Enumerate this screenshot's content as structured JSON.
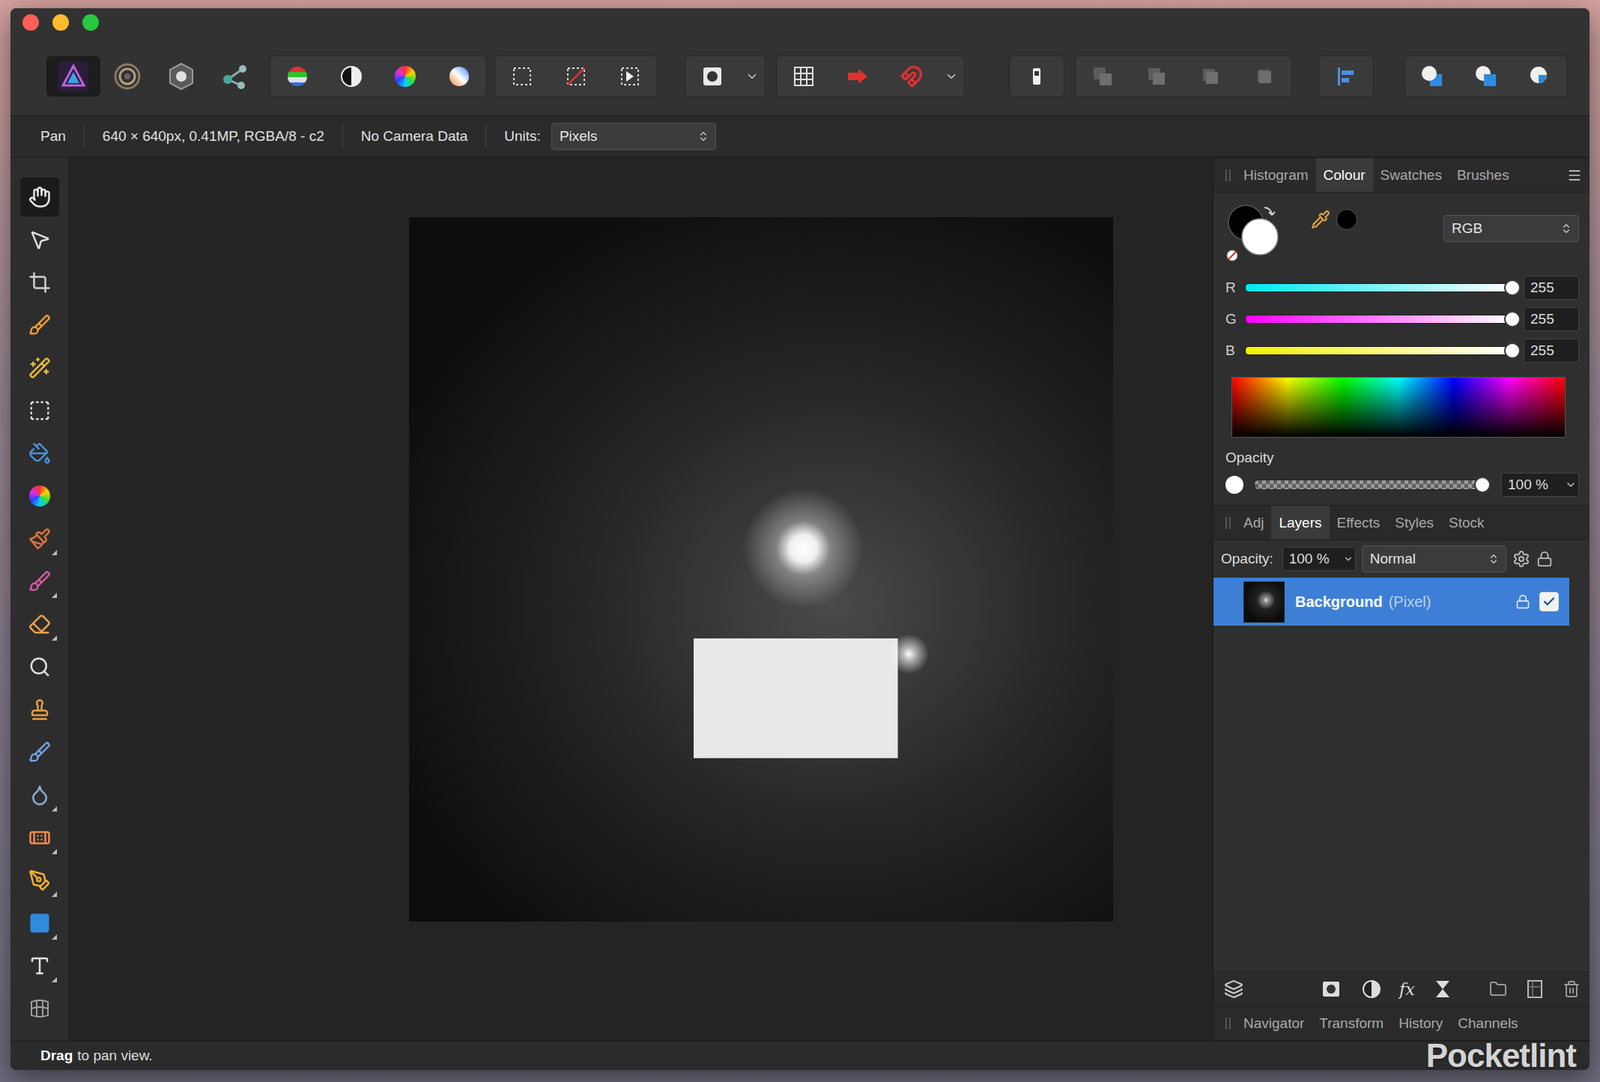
{
  "toolbar": {
    "personas": [
      {
        "selected": true
      },
      {
        "selected": false
      },
      {
        "selected": false
      },
      {
        "selected": false
      }
    ]
  },
  "context_bar": {
    "tool": "Pan",
    "document_info": "640 × 640px, 0.41MP, RGBA/8 - c2",
    "camera": "No Camera Data",
    "units_label": "Units:",
    "units": "Pixels"
  },
  "tools": [
    {
      "selected": true,
      "flyout": false
    },
    {
      "selected": false,
      "flyout": false
    },
    {
      "selected": false,
      "flyout": false
    },
    {
      "selected": false,
      "flyout": false
    },
    {
      "selected": false,
      "flyout": false
    },
    {
      "selected": false,
      "flyout": false
    },
    {
      "selected": false,
      "flyout": false
    },
    {
      "selected": false,
      "flyout": false
    },
    {
      "selected": false,
      "flyout": true
    },
    {
      "selected": false,
      "flyout": true
    },
    {
      "selected": false,
      "flyout": true
    },
    {
      "selected": false,
      "flyout": false
    },
    {
      "selected": false,
      "flyout": false
    },
    {
      "selected": false,
      "flyout": false
    },
    {
      "selected": false,
      "flyout": true
    },
    {
      "selected": false,
      "flyout": true
    },
    {
      "selected": false,
      "flyout": true
    },
    {
      "selected": false,
      "flyout": true
    },
    {
      "selected": false,
      "flyout": true
    },
    {
      "selected": false,
      "flyout": false
    }
  ],
  "colour_panel": {
    "tabs": [
      {
        "label": "Histogram",
        "selected": false
      },
      {
        "label": "Colour",
        "selected": true
      },
      {
        "label": "Swatches",
        "selected": false
      },
      {
        "label": "Brushes",
        "selected": false
      }
    ],
    "model": "RGB",
    "channels": [
      {
        "name": "R",
        "value": "255",
        "level": 1,
        "color": "#00e8f0"
      },
      {
        "name": "G",
        "value": "255",
        "level": 1,
        "color": "#ff00ff"
      },
      {
        "name": "B",
        "value": "255",
        "level": 1,
        "color": "#f2f200"
      }
    ],
    "opacity_label": "Opacity",
    "opacity": "100 %",
    "opacity_level": 1
  },
  "layers_panel": {
    "tabs": [
      {
        "label": "Adj",
        "selected": false
      },
      {
        "label": "Layers",
        "selected": true
      },
      {
        "label": "Effects",
        "selected": false
      },
      {
        "label": "Styles",
        "selected": false
      },
      {
        "label": "Stock",
        "selected": false
      }
    ],
    "opacity_label": "Opacity:",
    "opacity": "100 %",
    "blend_mode": "Normal",
    "layers": [
      {
        "name": "Background",
        "type": "(Pixel)",
        "selected": true,
        "locked": true,
        "visible": true
      }
    ],
    "fx_label": "fx"
  },
  "bottom_tabs": [
    {
      "label": "Navigator",
      "selected": false
    },
    {
      "label": "Transform",
      "selected": false
    },
    {
      "label": "History",
      "selected": false
    },
    {
      "label": "Channels",
      "selected": false
    }
  ],
  "status_bar": {
    "key": "Drag",
    "text": "to pan view."
  },
  "watermark": "Pocketlint"
}
